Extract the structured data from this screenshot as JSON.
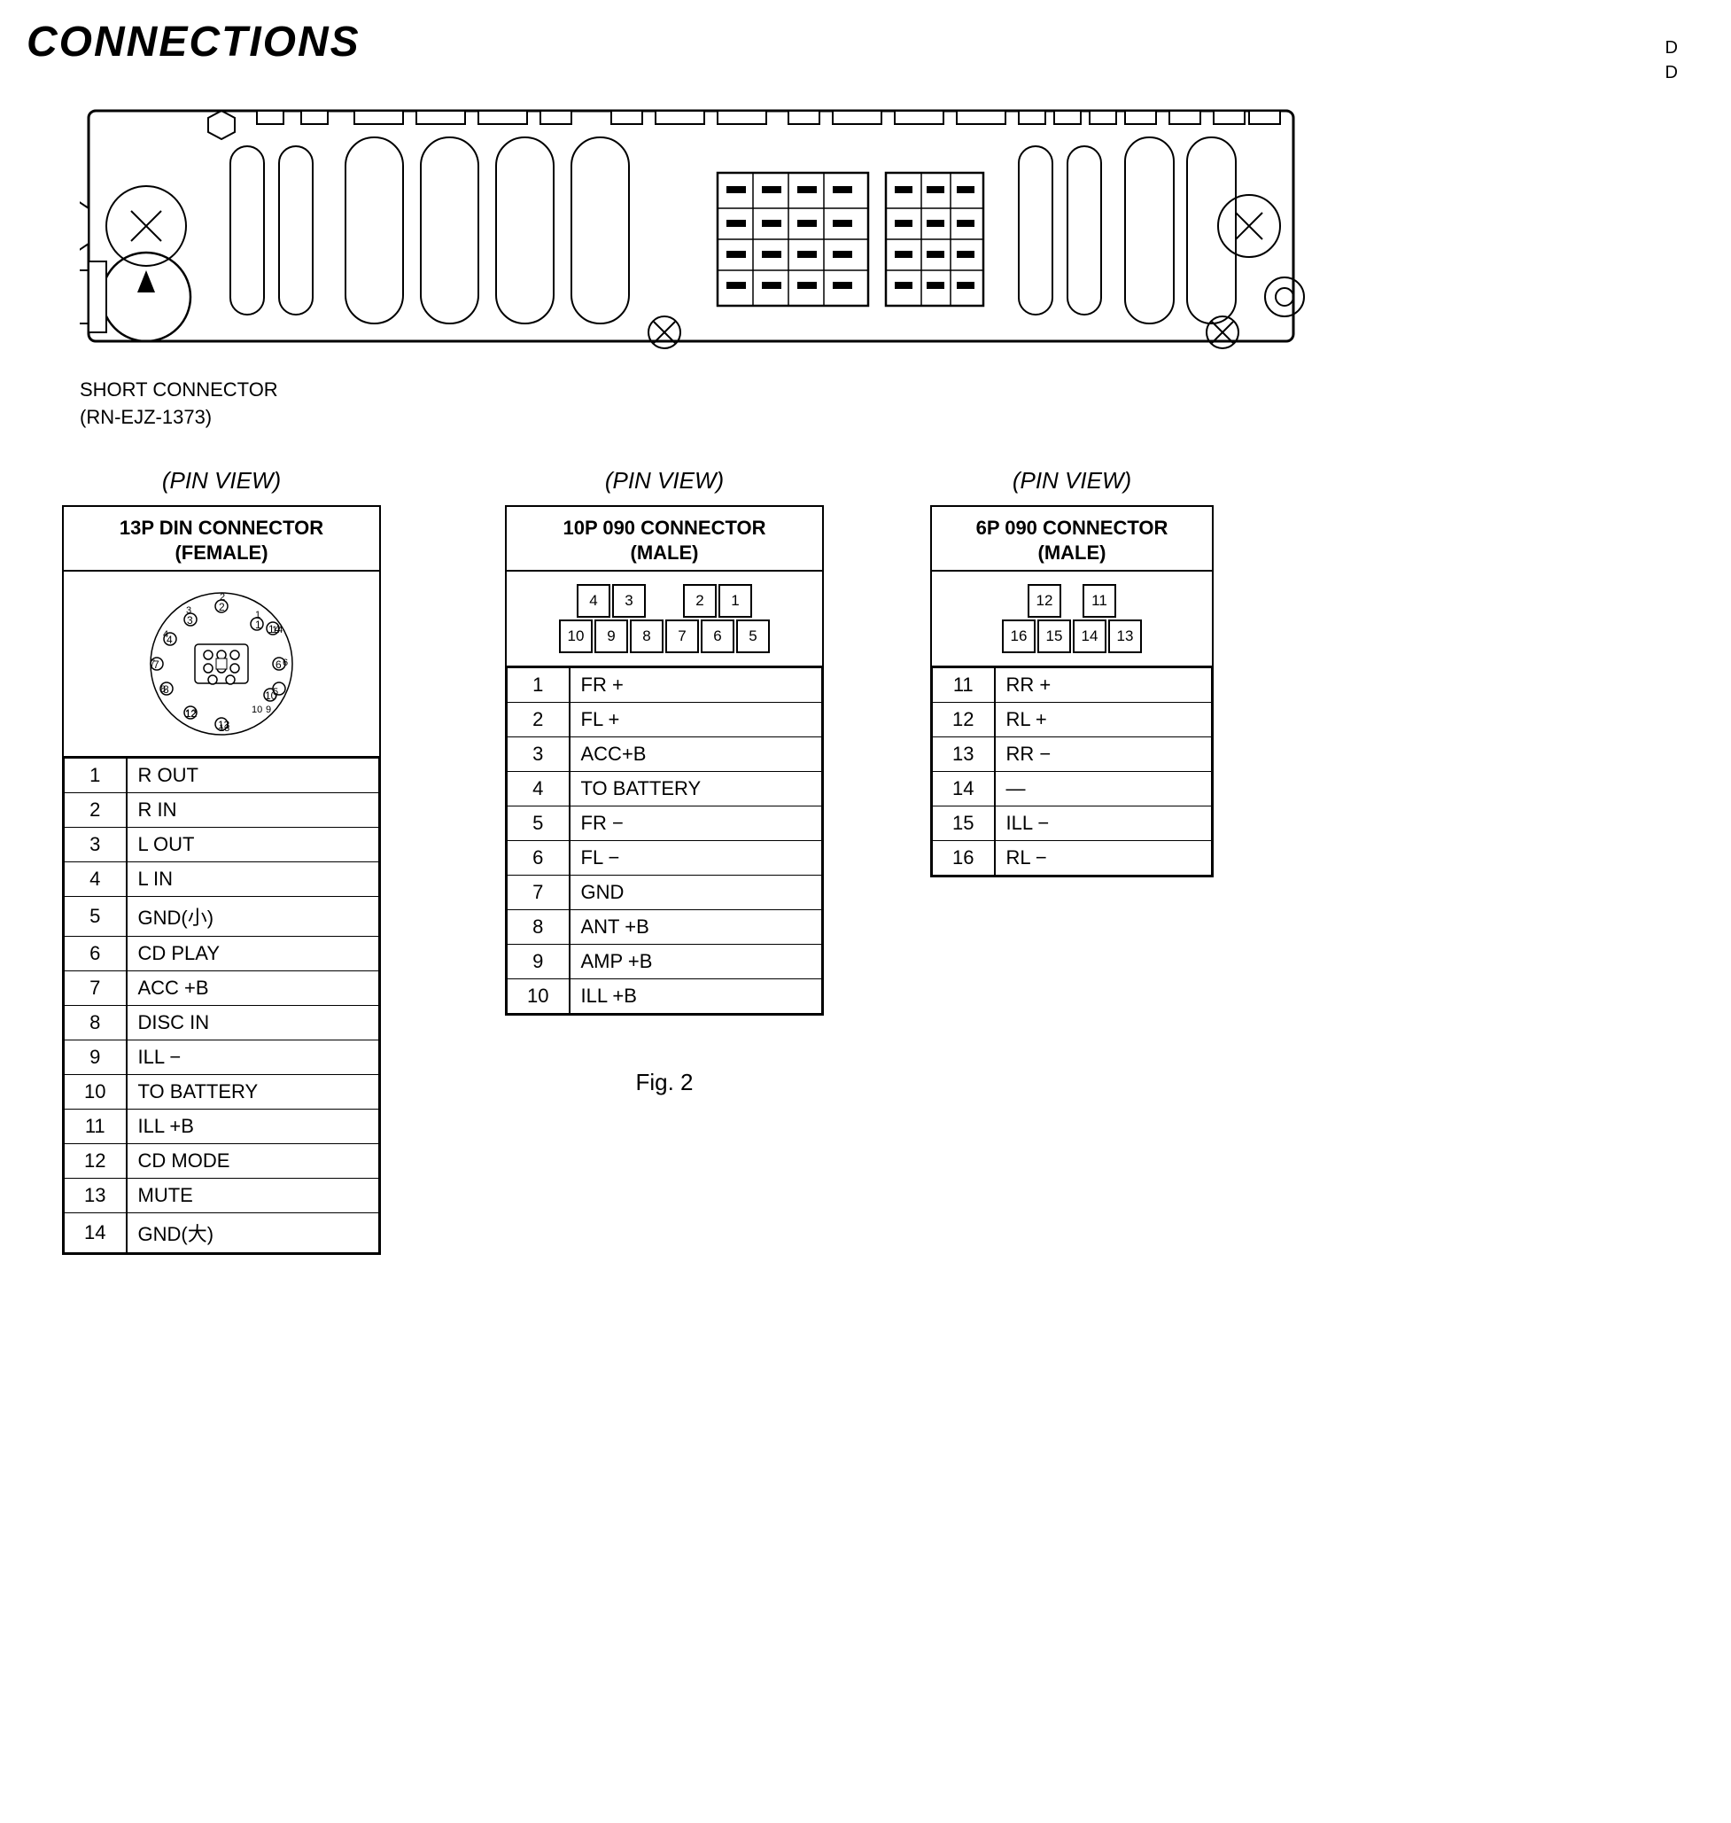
{
  "page": {
    "title": "CONNECTIONS",
    "top_right_note": "D\nD",
    "short_connector_label": "SHORT CONNECTOR\n(RN-EJZ-1373)",
    "fig_label": "Fig. 2"
  },
  "pin_sections": [
    {
      "view_label": "(PIN  VIEW)",
      "connector_title": "13P DIN CONNECTOR\n(FEMALE)",
      "pins": [
        {
          "num": "1",
          "label": "R OUT"
        },
        {
          "num": "2",
          "label": "R IN"
        },
        {
          "num": "3",
          "label": "L OUT"
        },
        {
          "num": "4",
          "label": "L IN"
        },
        {
          "num": "5",
          "label": "GND(小)"
        },
        {
          "num": "6",
          "label": "CD PLAY"
        },
        {
          "num": "7",
          "label": "ACC +B"
        },
        {
          "num": "8",
          "label": "DISC IN"
        },
        {
          "num": "9",
          "label": "ILL −"
        },
        {
          "num": "10",
          "label": "TO BATTERY"
        },
        {
          "num": "11",
          "label": "ILL +B"
        },
        {
          "num": "12",
          "label": "CD MODE"
        },
        {
          "num": "13",
          "label": "MUTE"
        },
        {
          "num": "14",
          "label": "GND(大)"
        }
      ]
    },
    {
      "view_label": "(PIN  VIEW)",
      "connector_title": "10P 090 CONNECTOR\n(MALE)",
      "diagram_rows": [
        [
          "4",
          "3",
          "",
          "2",
          "1"
        ],
        [
          "10",
          "9",
          "8",
          "7",
          "6",
          "5"
        ]
      ],
      "pins": [
        {
          "num": "1",
          "label": "FR +"
        },
        {
          "num": "2",
          "label": "FL +"
        },
        {
          "num": "3",
          "label": "ACC+B"
        },
        {
          "num": "4",
          "label": "TO BATTERY"
        },
        {
          "num": "5",
          "label": "FR −"
        },
        {
          "num": "6",
          "label": "FL −"
        },
        {
          "num": "7",
          "label": "GND"
        },
        {
          "num": "8",
          "label": "ANT +B"
        },
        {
          "num": "9",
          "label": "AMP +B"
        },
        {
          "num": "10",
          "label": "ILL +B"
        }
      ]
    },
    {
      "view_label": "(PIN  VIEW)",
      "connector_title": "6P 090 CONNECTOR\n(MALE)",
      "diagram_rows_6p": [
        [
          "12",
          "",
          "11"
        ],
        [
          "16",
          "15",
          "14",
          "13"
        ]
      ],
      "pins": [
        {
          "num": "11",
          "label": "RR +"
        },
        {
          "num": "12",
          "label": "RL +"
        },
        {
          "num": "13",
          "label": "RR −"
        },
        {
          "num": "14",
          "label": "—"
        },
        {
          "num": "15",
          "label": "ILL −"
        },
        {
          "num": "16",
          "label": "RL −"
        }
      ]
    }
  ]
}
